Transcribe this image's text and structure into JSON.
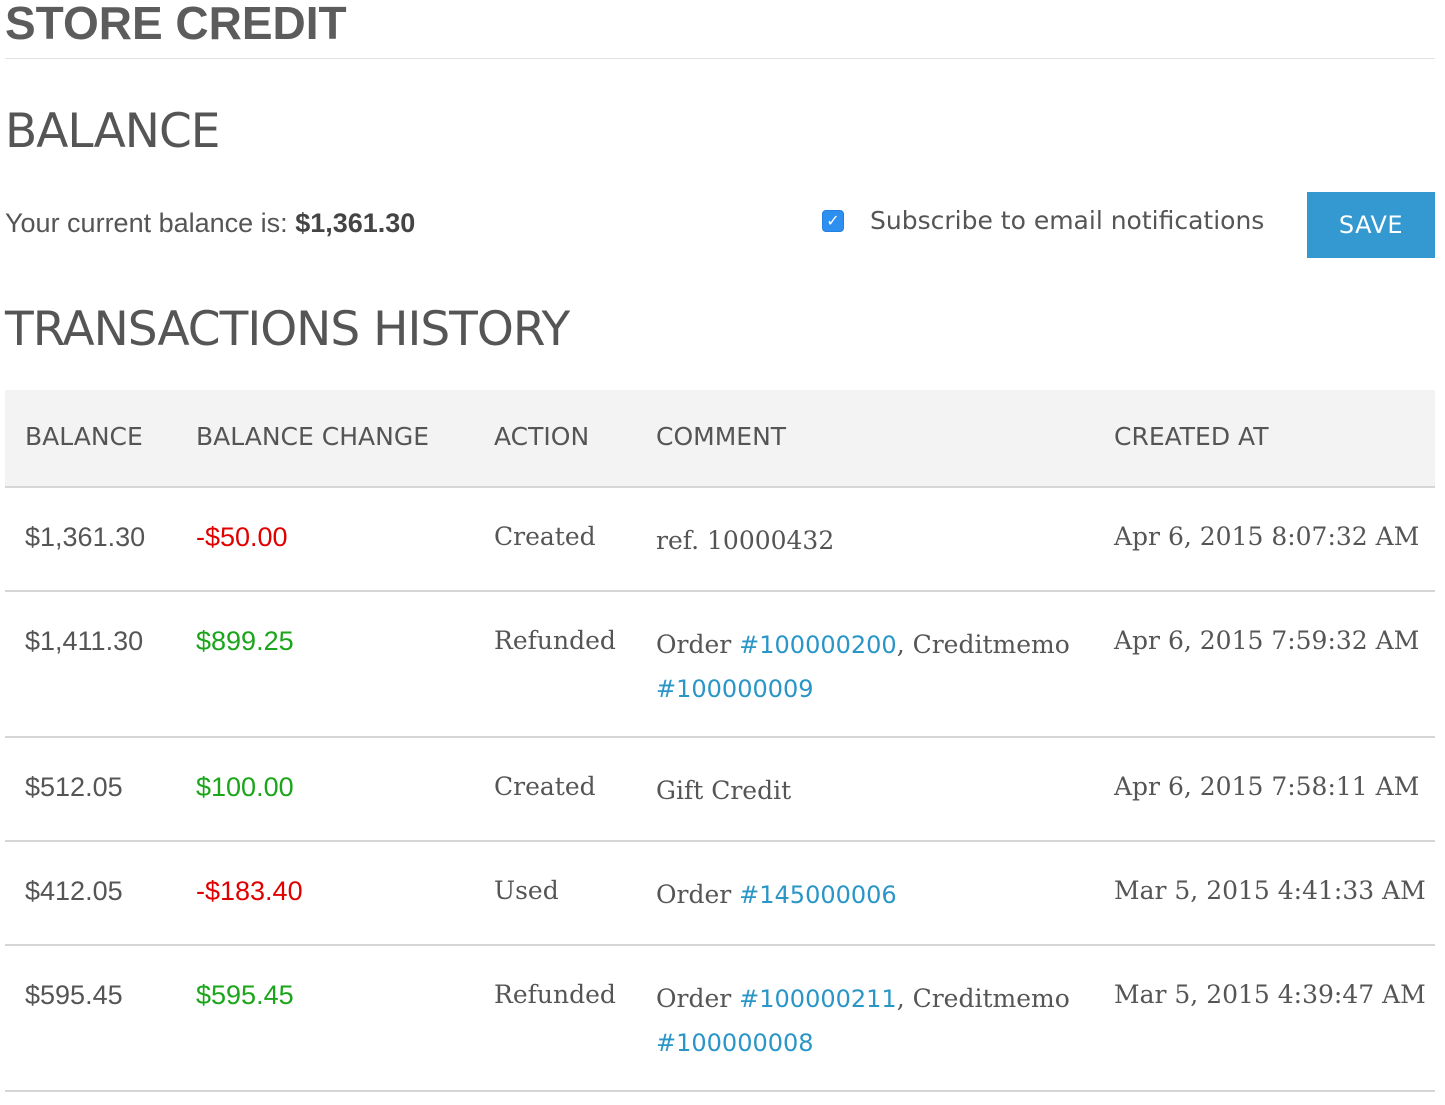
{
  "page": {
    "title": "STORE CREDIT"
  },
  "balance": {
    "heading": "BALANCE",
    "label": "Your current balance is:",
    "amount": "$1,361.30",
    "subscribe_label": "Subscribe to email notifications",
    "subscribe_checked": true,
    "save_label": "SAVE"
  },
  "history": {
    "heading": "TRANSACTIONS HISTORY",
    "columns": [
      "BALANCE",
      "BALANCE CHANGE",
      "ACTION",
      "COMMENT",
      "CREATED AT"
    ],
    "rows": [
      {
        "balance": "$1,361.30",
        "change": "-$50.00",
        "change_sign": "negative",
        "action": "Created",
        "comment": "ref. 10000432",
        "created_at": "Apr 6, 2015 8:07:32 AM"
      },
      {
        "balance": "$1,411.30",
        "change": "$899.25",
        "change_sign": "positive",
        "action": "Refunded",
        "comment_prefix": "Order ",
        "order_link": "#100000200",
        "comment_mid": ", Creditmemo",
        "memo_link": "#100000009",
        "created_at": "Apr 6, 2015 7:59:32 AM"
      },
      {
        "balance": "$512.05",
        "change": "$100.00",
        "change_sign": "positive",
        "action": "Created",
        "comment": "Gift Credit",
        "created_at": "Apr 6, 2015 7:58:11 AM"
      },
      {
        "balance": "$412.05",
        "change": "-$183.40",
        "change_sign": "negative",
        "action": "Used",
        "comment_prefix": "Order ",
        "order_link": "#145000006",
        "created_at": "Mar 5, 2015 4:41:33 AM"
      },
      {
        "balance": "$595.45",
        "change": "$595.45",
        "change_sign": "positive",
        "action": "Refunded",
        "comment_prefix": "Order ",
        "order_link": "#100000211",
        "comment_mid": ", Creditmemo",
        "memo_link": "#100000008",
        "created_at": "Mar 5, 2015 4:39:47 AM"
      }
    ]
  },
  "colors": {
    "negative": "#e00000",
    "positive": "#1aa51a",
    "link": "#2a96c8",
    "button": "#3399d0"
  },
  "icons": {
    "checkbox": "checkmark-icon"
  }
}
